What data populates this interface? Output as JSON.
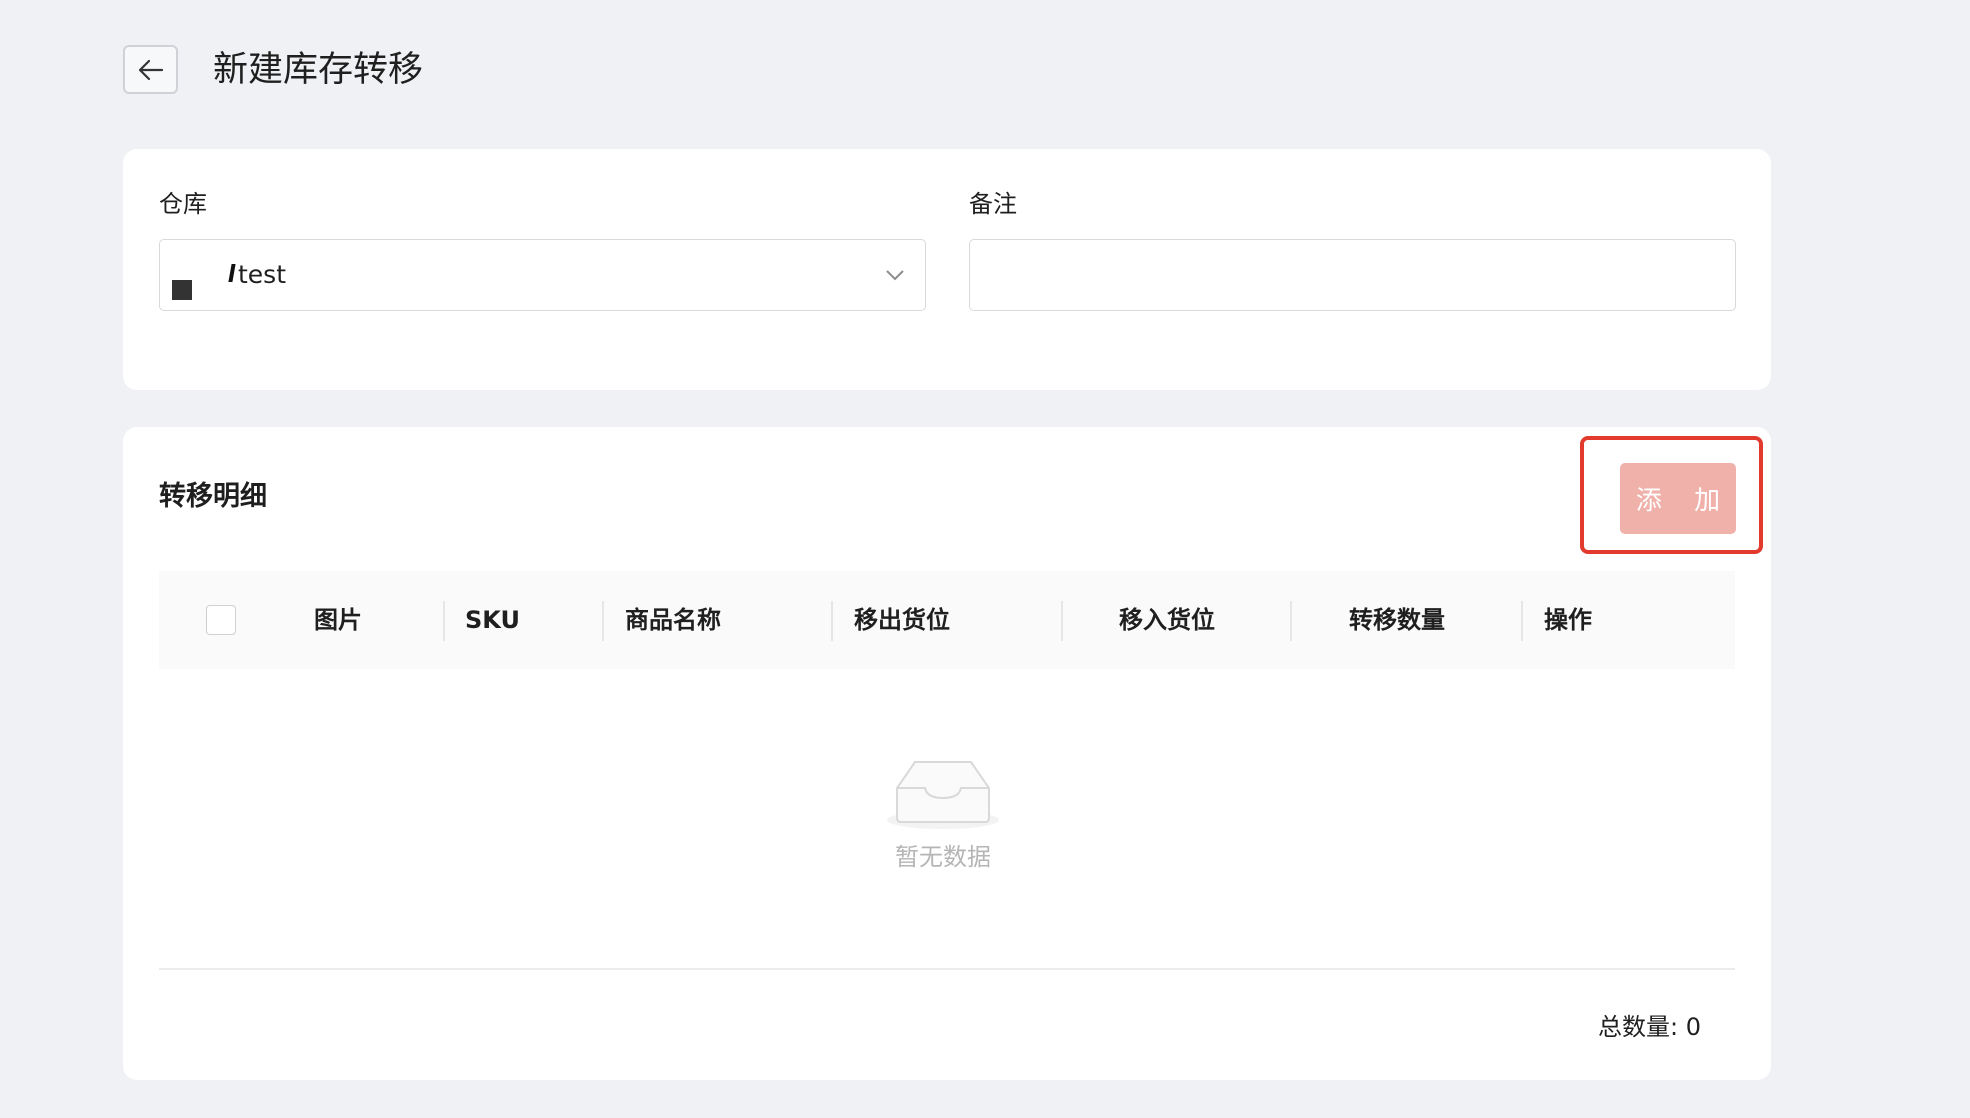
{
  "header": {
    "title": "新建库存转移",
    "back_icon": "arrow-left-icon"
  },
  "form": {
    "warehouse_label": "仓库",
    "warehouse_value": "test",
    "remark_label": "备注",
    "remark_value": ""
  },
  "detail": {
    "title": "转移明细",
    "add_label": "添 加",
    "columns": [
      "图片",
      "SKU",
      "商品名称",
      "移出货位",
      "移入货位",
      "转移数量",
      "操作"
    ],
    "empty_text": "暂无数据",
    "total_label": "总数量:",
    "total_value": "0"
  },
  "colors": {
    "background": "#f0f1f5",
    "card": "#ffffff",
    "add_button": "#efb1aa",
    "highlight": "#e23b2e"
  }
}
